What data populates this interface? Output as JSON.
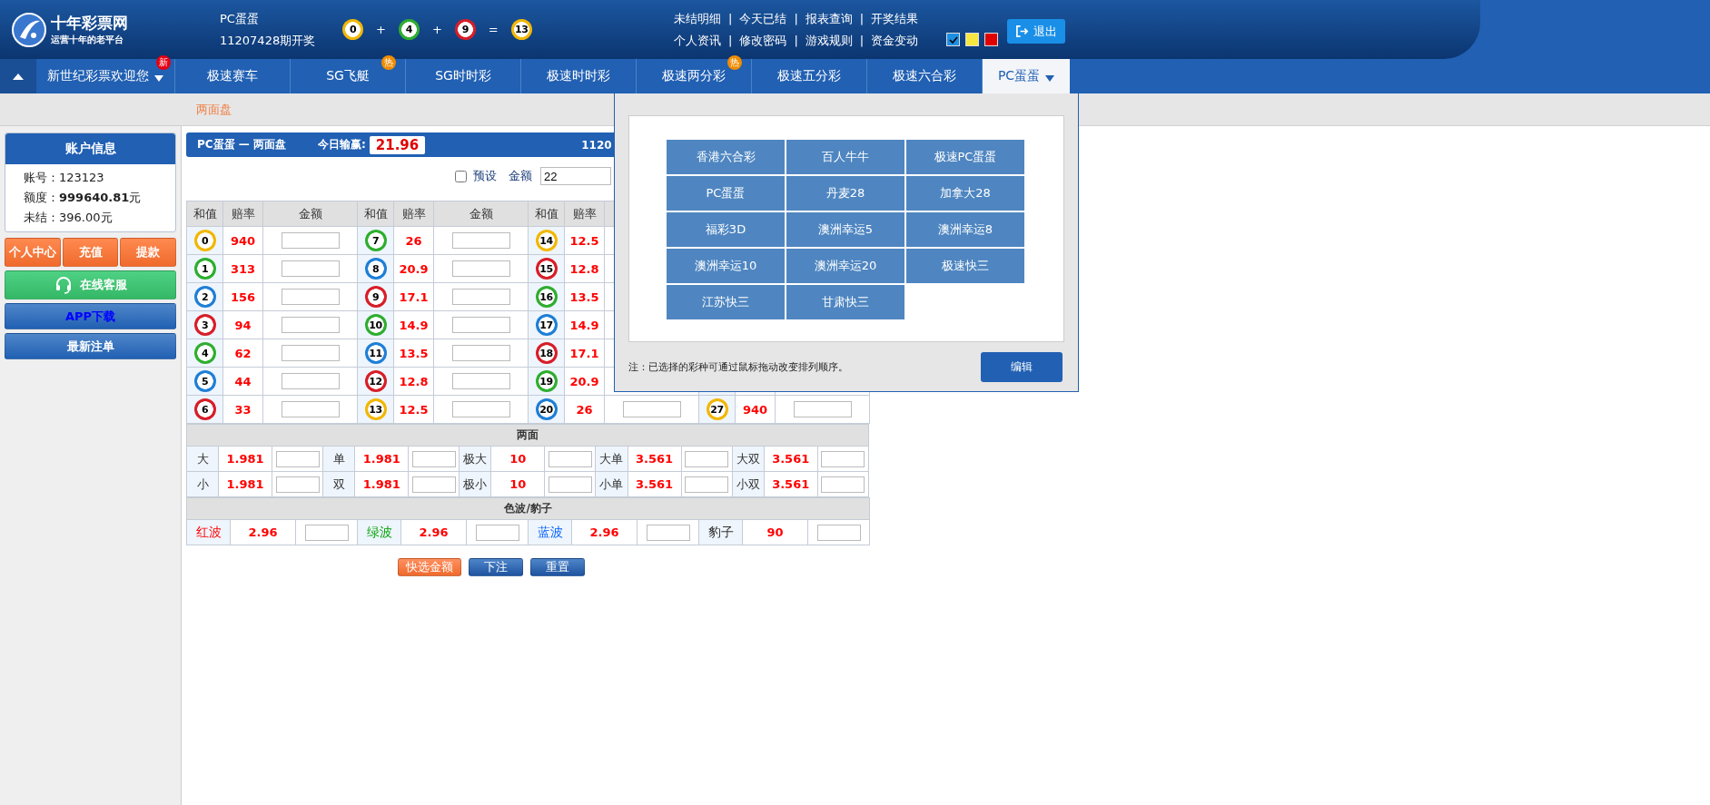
{
  "header": {
    "logo": {
      "name": "十年彩票网",
      "slogan": "运营十年的老平台"
    },
    "draw": {
      "game": "PC蛋蛋",
      "issue": "11207428期开奖",
      "items": [
        {
          "kind": "ball",
          "text": "0",
          "color": "#f2b705"
        },
        {
          "kind": "op",
          "text": "+"
        },
        {
          "kind": "ball",
          "text": "4",
          "color": "#2fae2f"
        },
        {
          "kind": "op",
          "text": "+"
        },
        {
          "kind": "ball",
          "text": "9",
          "color": "#d81e28"
        },
        {
          "kind": "op",
          "text": "="
        },
        {
          "kind": "ball",
          "text": "13",
          "color": "#f2b705"
        }
      ]
    },
    "link_rows": [
      [
        {
          "label": "未结明细"
        },
        {
          "label": "今天已结"
        },
        {
          "label": "报表查询"
        },
        {
          "label": "开奖结果"
        }
      ],
      [
        {
          "label": "个人资讯"
        },
        {
          "label": "修改密码"
        },
        {
          "label": "游戏规则"
        },
        {
          "label": "资金变动"
        }
      ]
    ],
    "separator": "|",
    "themes": [
      {
        "color": "#1a8fe3",
        "selected": true
      },
      {
        "color": "#f5e642",
        "selected": false
      },
      {
        "color": "#e00000",
        "selected": false
      }
    ],
    "logout": "退出"
  },
  "nav": {
    "tabs": [
      {
        "label": "新世纪彩票欢迎您",
        "badge": {
          "text": "新",
          "color": "#e60012"
        },
        "dropdown": true,
        "selected": false
      },
      {
        "label": "极速赛车",
        "dropdown": false,
        "selected": false
      },
      {
        "label": "SG飞艇",
        "badge": {
          "text": "热",
          "color": "#f08c00"
        },
        "dropdown": false,
        "selected": false
      },
      {
        "label": "SG时时彩",
        "dropdown": false,
        "selected": false
      },
      {
        "label": "极速时时彩",
        "dropdown": false,
        "selected": false
      },
      {
        "label": "极速两分彩",
        "badge": {
          "text": "热",
          "color": "#f08c00"
        },
        "dropdown": false,
        "selected": false
      },
      {
        "label": "极速五分彩",
        "dropdown": false,
        "selected": false
      },
      {
        "label": "极速六合彩",
        "dropdown": false,
        "selected": false
      },
      {
        "label": "PC蛋蛋",
        "dropdown": true,
        "selected": true
      }
    ]
  },
  "subnav": {
    "items": [
      {
        "label": "两面盘",
        "selected": true
      }
    ]
  },
  "account": {
    "title": "账户信息",
    "lines": [
      {
        "label": "账号：",
        "value": "123123",
        "strong": false
      },
      {
        "label": "额度：",
        "value": "999640.81",
        "unit": "元",
        "strong": true
      },
      {
        "label": "未结：",
        "value": "396.00",
        "unit": "元",
        "strong": false
      }
    ]
  },
  "side_buttons": [
    {
      "kind": "orange",
      "label": "个人中心"
    },
    {
      "kind": "orange",
      "label": "充值"
    },
    {
      "kind": "orange",
      "label": "提款"
    },
    {
      "kind": "support",
      "label": "在线客服"
    },
    {
      "kind": "download",
      "label": "APP下载"
    },
    {
      "kind": "plain",
      "label": "最新注单"
    }
  ],
  "panel": {
    "title": "PC蛋蛋 — 两面盘",
    "profit_label": "今日输赢:",
    "profit": "21.96",
    "issue": "1120"
  },
  "preset": {
    "label": "预设",
    "checked": false,
    "amount_label": "金额",
    "amount": "22"
  },
  "sum_table": {
    "groups": [
      {
        "headers": [
          "和值",
          "赔率",
          "金额"
        ],
        "cells": [
          {
            "number": "0",
            "color": "#f2b705",
            "odds": "940"
          },
          {
            "number": "1",
            "color": "#2fae2f",
            "odds": "313"
          },
          {
            "number": "2",
            "color": "#1f7fd6",
            "odds": "156"
          },
          {
            "number": "3",
            "color": "#d81e28",
            "odds": "94"
          },
          {
            "number": "4",
            "color": "#2fae2f",
            "odds": "62"
          },
          {
            "number": "5",
            "color": "#1f7fd6",
            "odds": "44"
          },
          {
            "number": "6",
            "color": "#d81e28",
            "odds": "33"
          }
        ]
      },
      {
        "headers": [
          "和值",
          "赔率",
          "金额"
        ],
        "cells": [
          {
            "number": "7",
            "color": "#2fae2f",
            "odds": "26"
          },
          {
            "number": "8",
            "color": "#1f7fd6",
            "odds": "20.9"
          },
          {
            "number": "9",
            "color": "#d81e28",
            "odds": "17.1"
          },
          {
            "number": "10",
            "color": "#2fae2f",
            "odds": "14.9"
          },
          {
            "number": "11",
            "color": "#1f7fd6",
            "odds": "13.5"
          },
          {
            "number": "12",
            "color": "#d81e28",
            "odds": "12.8"
          },
          {
            "number": "13",
            "color": "#f2b705",
            "odds": "12.5"
          }
        ]
      },
      {
        "headers": [
          "和值",
          "赔率"
        ],
        "cells": [
          {
            "number": "14",
            "color": "#f2b705",
            "odds": "12.5"
          },
          {
            "number": "15",
            "color": "#d81e28",
            "odds": "12.8"
          },
          {
            "number": "16",
            "color": "#2fae2f",
            "odds": "13.5"
          },
          {
            "number": "17",
            "color": "#1f7fd6",
            "odds": "14.9"
          },
          {
            "number": "18",
            "color": "#d81e28",
            "odds": "17.1"
          },
          {
            "number": "19",
            "color": "#2fae2f",
            "odds": "20.9"
          },
          {
            "number": "20",
            "color": "#1f7fd6",
            "odds": "26"
          }
        ]
      },
      {
        "cells": [
          null,
          null,
          null,
          null,
          null,
          null,
          {
            "number": "27",
            "color": "#f2b705",
            "odds": "940"
          }
        ]
      }
    ]
  },
  "two_sides": {
    "title": "两面",
    "rows": [
      [
        {
          "label": "大",
          "odds": "1.981"
        },
        {
          "label": "单",
          "odds": "1.981"
        },
        {
          "label": "极大",
          "odds": "10"
        },
        {
          "label": "大单",
          "odds": "3.561"
        },
        {
          "label": "大双",
          "odds": "3.561"
        }
      ],
      [
        {
          "label": "小",
          "odds": "1.981"
        },
        {
          "label": "双",
          "odds": "1.981"
        },
        {
          "label": "极小",
          "odds": "10"
        },
        {
          "label": "小单",
          "odds": "3.561"
        },
        {
          "label": "小双",
          "odds": "3.561"
        }
      ]
    ]
  },
  "color_wave": {
    "title": "色波/豹子",
    "items": [
      {
        "label": "红波",
        "color": "#ff0000",
        "odds": "2.96"
      },
      {
        "label": "绿波",
        "color": "#00a000",
        "odds": "2.96"
      },
      {
        "label": "蓝波",
        "color": "#0060ff",
        "odds": "2.96"
      },
      {
        "label": "豹子",
        "color": "#333333",
        "odds": "90"
      }
    ]
  },
  "actions": [
    {
      "kind": "quick",
      "label": "快选金额"
    },
    {
      "kind": "submit",
      "label": "下注"
    },
    {
      "kind": "reset",
      "label": "重置"
    }
  ],
  "popup": {
    "games": [
      {
        "label": "香港六合彩"
      },
      {
        "label": "百人牛牛"
      },
      {
        "label": "极速PC蛋蛋"
      },
      {
        "label": "PC蛋蛋"
      },
      {
        "label": "丹麦28"
      },
      {
        "label": "加拿大28"
      },
      {
        "label": "福彩3D"
      },
      {
        "label": "澳洲幸运5"
      },
      {
        "label": "澳洲幸运8"
      },
      {
        "label": "澳洲幸运10"
      },
      {
        "label": "澳洲幸运20"
      },
      {
        "label": "极速快三"
      },
      {
        "label": "江苏快三"
      },
      {
        "label": "甘肃快三"
      }
    ],
    "note": "注：已选择的彩种可通过鼠标拖动改变排列顺序。",
    "edit": "编辑"
  }
}
